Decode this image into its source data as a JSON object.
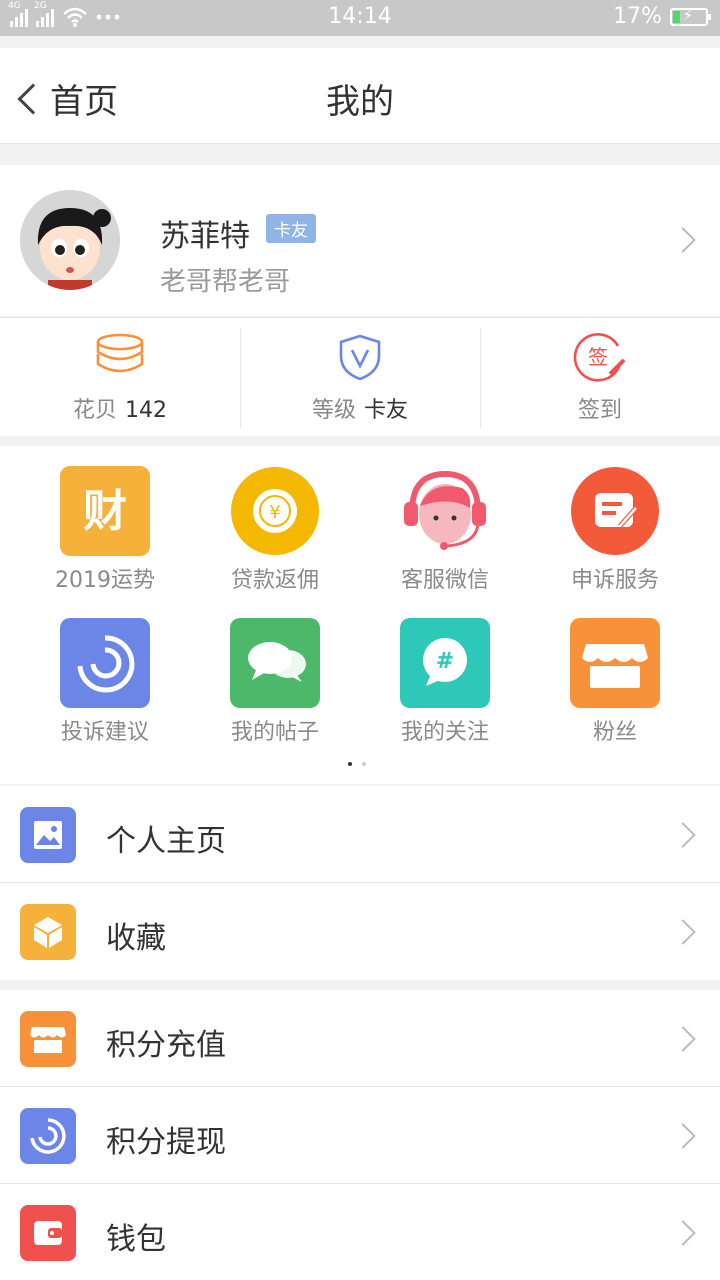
{
  "status_bar": {
    "time": "14:14",
    "battery": "17%",
    "sim1_label": "4G",
    "sim2_label": "2G"
  },
  "nav": {
    "back_label": "首页",
    "title": "我的"
  },
  "profile": {
    "name": "苏菲特",
    "badge": "卡友",
    "subtitle": "老哥帮老哥"
  },
  "stats": [
    {
      "label": "花贝",
      "value": "142",
      "icon": "coins-icon"
    },
    {
      "label": "等级",
      "value": "卡友",
      "icon": "shield-v-icon"
    },
    {
      "label": "签到",
      "value": "",
      "icon": "sign-in-icon"
    }
  ],
  "grid": {
    "items": [
      {
        "label": "2019运势",
        "icon": "fortune-icon",
        "color": "#f5b13a"
      },
      {
        "label": "贷款返佣",
        "icon": "coin-yen-icon",
        "color": "#f5b800"
      },
      {
        "label": "客服微信",
        "icon": "headset-icon",
        "color": "#f05a6e"
      },
      {
        "label": "申诉服务",
        "icon": "edit-note-icon",
        "color": "#f25a3a"
      },
      {
        "label": "投诉建议",
        "icon": "spiral-icon",
        "color": "#6b86e6"
      },
      {
        "label": "我的帖子",
        "icon": "chat-bubbles-icon",
        "color": "#4bb86a"
      },
      {
        "label": "我的关注",
        "icon": "hashtag-icon",
        "color": "#2ec8b8"
      },
      {
        "label": "粉丝",
        "icon": "shop-icon",
        "color": "#f7923a"
      }
    ],
    "fortune_glyph": "财",
    "yen_glyph": "¥",
    "hash_glyph": "#",
    "sign_glyph": "签"
  },
  "menu_group_1": [
    {
      "label": "个人主页",
      "icon": "image-icon",
      "color": "#6b86e6"
    },
    {
      "label": "收藏",
      "icon": "box-icon",
      "color": "#f5b13a"
    }
  ],
  "menu_group_2": [
    {
      "label": "积分充值",
      "icon": "shop-icon",
      "color": "#f7923a"
    },
    {
      "label": "积分提现",
      "icon": "spiral-icon",
      "color": "#6b86e6"
    },
    {
      "label": "钱包",
      "icon": "wallet-icon",
      "color": "#f0504e"
    }
  ]
}
